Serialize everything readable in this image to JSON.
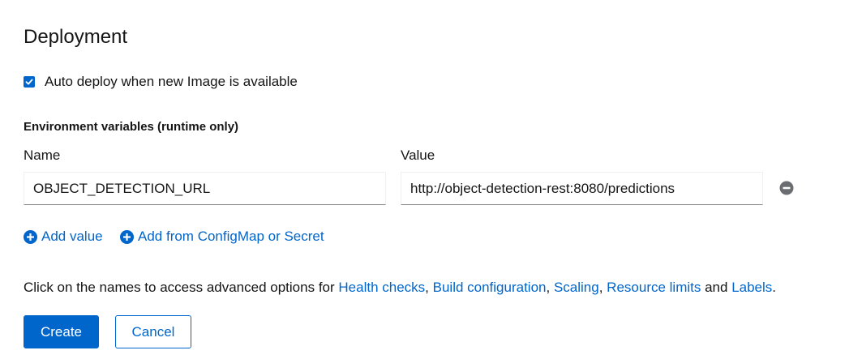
{
  "section": {
    "title": "Deployment"
  },
  "auto_deploy": {
    "label": "Auto deploy when new Image is available",
    "checked": true
  },
  "env": {
    "title": "Environment variables (runtime only)",
    "name_header": "Name",
    "value_header": "Value",
    "rows": [
      {
        "name": "OBJECT_DETECTION_URL",
        "value": "http://object-detection-rest:8080/predictions"
      }
    ],
    "add_value_label": "Add value",
    "add_from_config_label": "Add from ConfigMap or Secret"
  },
  "advanced": {
    "prefix": "Click on the names to access advanced options for ",
    "links": [
      "Health checks",
      "Build configuration",
      "Scaling",
      "Resource limits",
      "Labels"
    ],
    "separator": ", ",
    "conjunction": " and ",
    "suffix": "."
  },
  "actions": {
    "create_label": "Create",
    "cancel_label": "Cancel"
  },
  "colors": {
    "accent": "#0066cc",
    "text": "#151515",
    "remove_icon": "#6a6e73"
  },
  "icons": {
    "checkbox": "check-icon",
    "remove": "minus-circle-icon",
    "add": "plus-circle-icon"
  }
}
